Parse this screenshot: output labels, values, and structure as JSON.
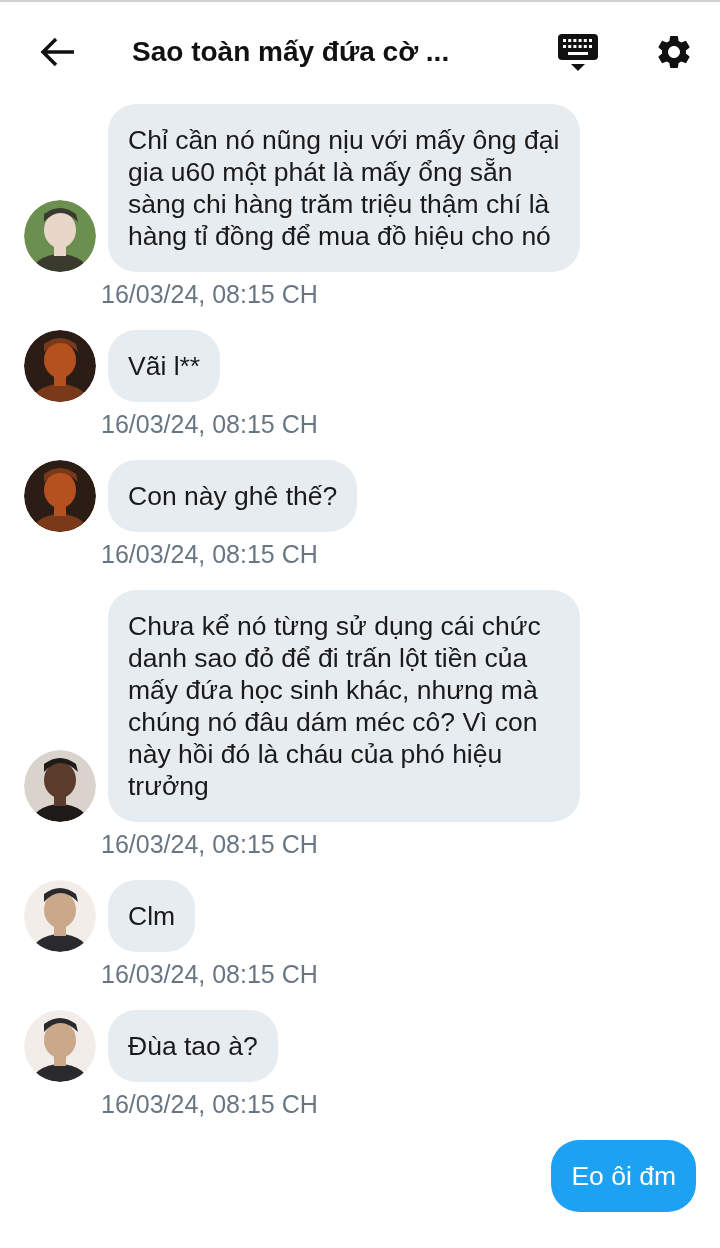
{
  "header": {
    "title": "Sao toàn mấy đứa cờ ..."
  },
  "messages": [
    {
      "kind": "received",
      "text": "Chỉ cần nó nũng nịu với mấy ông đại gia u60 một phát là mấy ổng sẵn sàng chi hàng trăm triệu thậm chí là hàng tỉ đồng để mua đồ hiệu cho nó",
      "time": "16/03/24, 08:15 CH"
    },
    {
      "kind": "received",
      "text": "Vãi l**",
      "time": "16/03/24, 08:15 CH"
    },
    {
      "kind": "received",
      "text": "Con này ghê thế?",
      "time": "16/03/24, 08:15 CH"
    },
    {
      "kind": "received",
      "text": "Chưa kể nó từng sử dụng cái chức danh sao đỏ để đi trấn lột tiền của mấy đứa học sinh khác, nhưng mà chúng nó đâu dám méc cô? Vì con này hồi đó là cháu của phó hiệu trưởng",
      "time": "16/03/24, 08:15 CH"
    },
    {
      "kind": "received",
      "text": "Clm",
      "time": "16/03/24, 08:15 CH"
    },
    {
      "kind": "received",
      "text": "Đùa tao à?",
      "time": "16/03/24, 08:15 CH"
    },
    {
      "kind": "sent",
      "text": "Eo ôi đm"
    }
  ]
}
